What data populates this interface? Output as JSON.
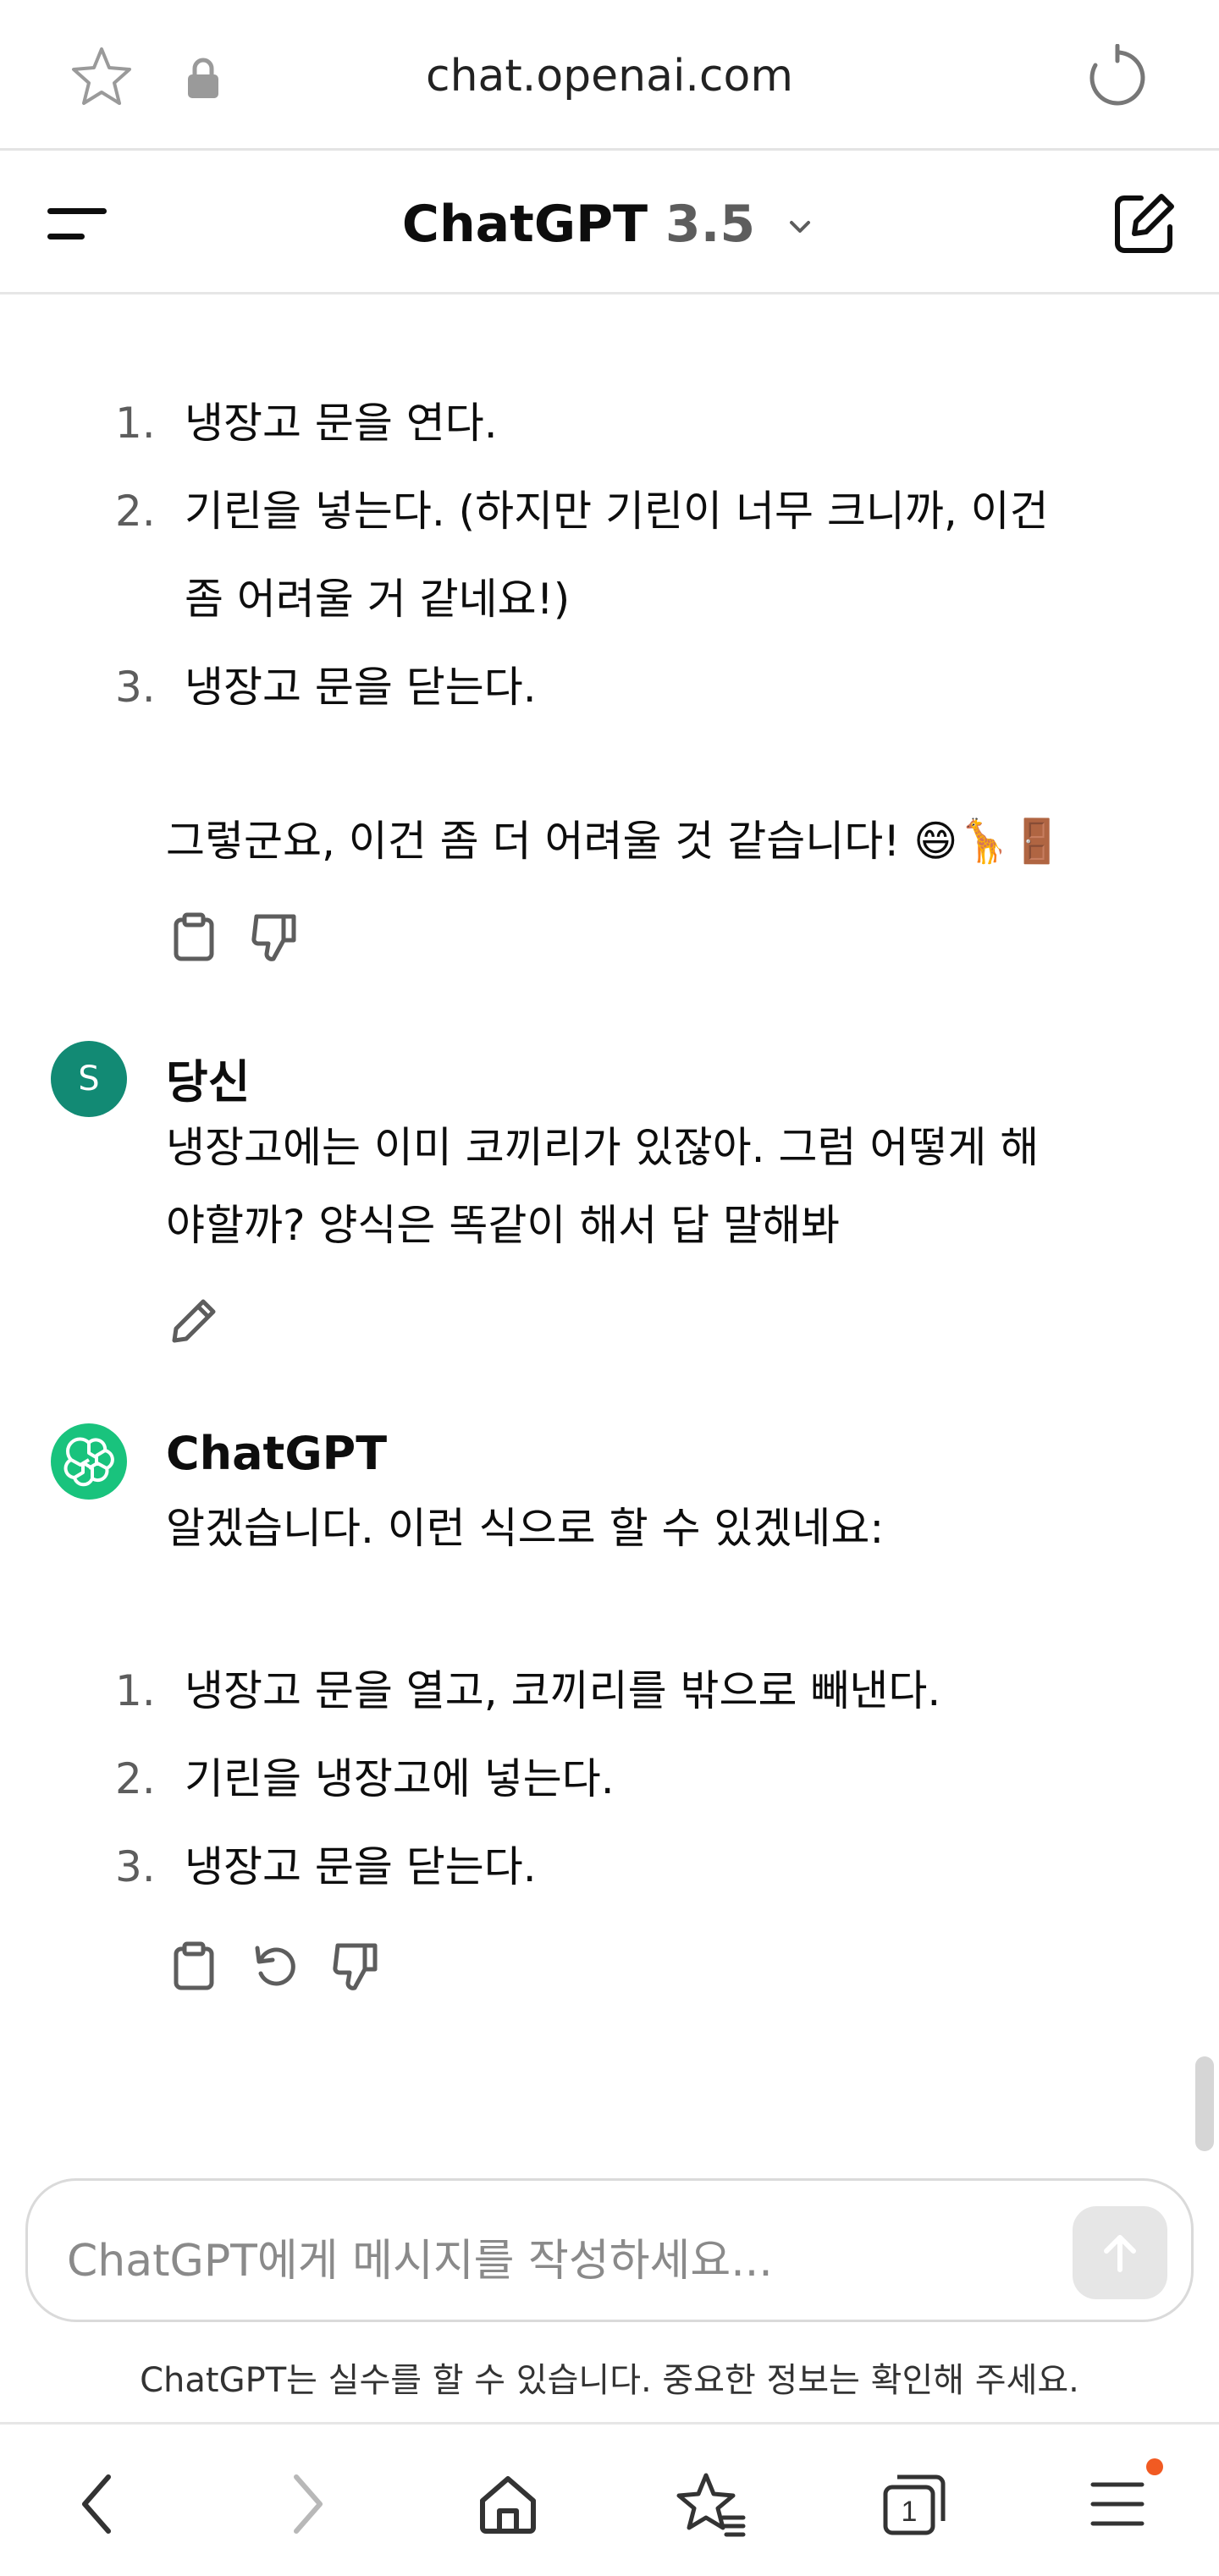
{
  "browser": {
    "url": "chat.openai.com",
    "icons": [
      "star-icon",
      "lock-icon",
      "reload-icon"
    ]
  },
  "header": {
    "title": "ChatGPT",
    "version": "3.5",
    "icons": [
      "menu-icon",
      "chevron-down-icon",
      "compose-icon"
    ]
  },
  "conversation": {
    "prev_answer": {
      "list": [
        {
          "num": "1.",
          "text": "냉장고 문을 연다."
        },
        {
          "num": "2.",
          "text": "기린을 넣는다. (하지만 기린이 너무 크니까, 이건"
        },
        {
          "num": "",
          "text": "좀 어려울 거 같네요!)"
        },
        {
          "num": "3.",
          "text": "냉장고 문을 닫는다."
        }
      ],
      "closing": "그렇군요, 이건 좀 더 어려울 것 같습니다! 😄🦒🚪"
    },
    "user_message": {
      "avatar_letter": "S",
      "author": "당신",
      "lines": [
        "냉장고에는 이미 코끼리가 있잖아. 그럼 어떻게 해",
        "야할까? 양식은 똑같이 해서 답 말해봐"
      ]
    },
    "assistant_message": {
      "author": "ChatGPT",
      "intro": "알겠습니다. 이런 식으로 할 수 있겠네요:",
      "list": [
        {
          "num": "1.",
          "text": "냉장고 문을 열고, 코끼리를 밖으로 빼낸다."
        },
        {
          "num": "2.",
          "text": "기린을 냉장고에 넣는다."
        },
        {
          "num": "3.",
          "text": "냉장고 문을 닫는다."
        }
      ]
    }
  },
  "composer": {
    "placeholder": "ChatGPT에게 메시지를 작성하세요...",
    "disclaimer": "ChatGPT는 실수를 할 수 있습니다. 중요한 정보는 확인해 주세요."
  },
  "bottom_nav": {
    "tab_count": "1",
    "icons": [
      "back-icon",
      "forward-icon",
      "home-icon",
      "bookmarks-icon",
      "tabs-icon",
      "menu-icon"
    ]
  },
  "colors": {
    "user_avatar": "#128a74",
    "gpt_avatar": "#19c37d",
    "badge": "#f15a22"
  }
}
